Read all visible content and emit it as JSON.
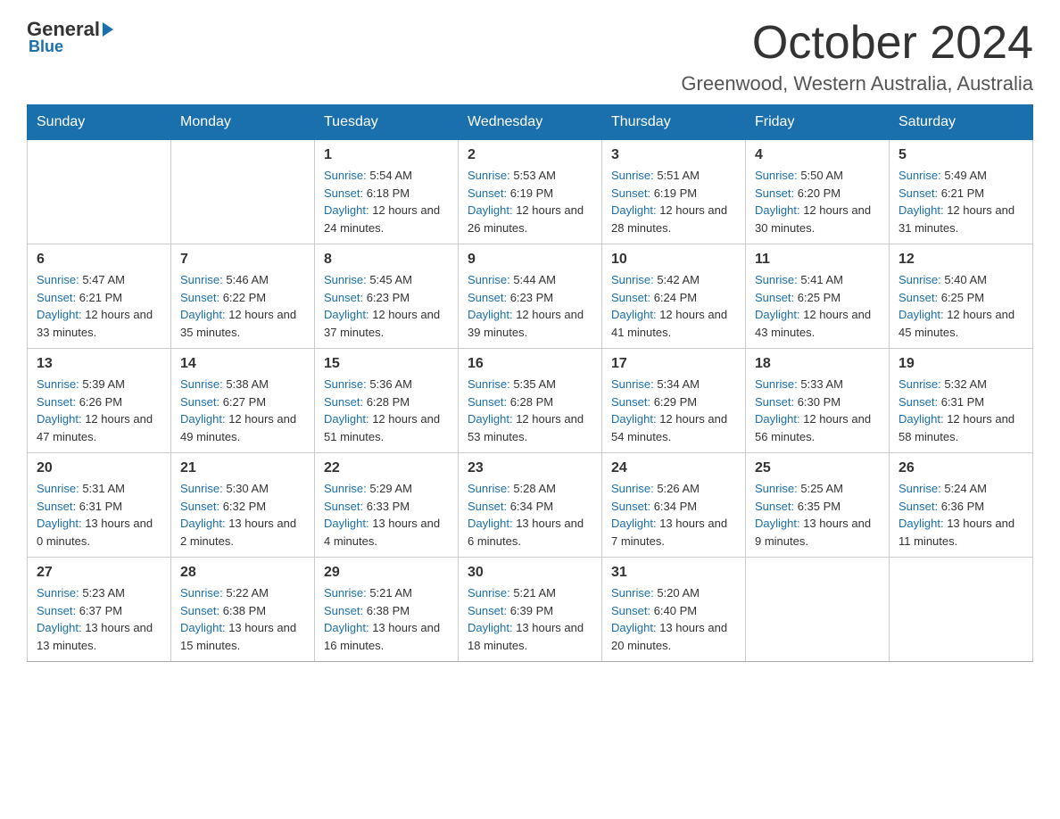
{
  "header": {
    "logo_general": "General",
    "logo_blue": "Blue",
    "month_title": "October 2024",
    "location": "Greenwood, Western Australia, Australia"
  },
  "days_of_week": [
    "Sunday",
    "Monday",
    "Tuesday",
    "Wednesday",
    "Thursday",
    "Friday",
    "Saturday"
  ],
  "weeks": [
    [
      {
        "day": "",
        "info": ""
      },
      {
        "day": "",
        "info": ""
      },
      {
        "day": "1",
        "sunrise": "5:54 AM",
        "sunset": "6:18 PM",
        "daylight": "12 hours and 24 minutes."
      },
      {
        "day": "2",
        "sunrise": "5:53 AM",
        "sunset": "6:19 PM",
        "daylight": "12 hours and 26 minutes."
      },
      {
        "day": "3",
        "sunrise": "5:51 AM",
        "sunset": "6:19 PM",
        "daylight": "12 hours and 28 minutes."
      },
      {
        "day": "4",
        "sunrise": "5:50 AM",
        "sunset": "6:20 PM",
        "daylight": "12 hours and 30 minutes."
      },
      {
        "day": "5",
        "sunrise": "5:49 AM",
        "sunset": "6:21 PM",
        "daylight": "12 hours and 31 minutes."
      }
    ],
    [
      {
        "day": "6",
        "sunrise": "5:47 AM",
        "sunset": "6:21 PM",
        "daylight": "12 hours and 33 minutes."
      },
      {
        "day": "7",
        "sunrise": "5:46 AM",
        "sunset": "6:22 PM",
        "daylight": "12 hours and 35 minutes."
      },
      {
        "day": "8",
        "sunrise": "5:45 AM",
        "sunset": "6:23 PM",
        "daylight": "12 hours and 37 minutes."
      },
      {
        "day": "9",
        "sunrise": "5:44 AM",
        "sunset": "6:23 PM",
        "daylight": "12 hours and 39 minutes."
      },
      {
        "day": "10",
        "sunrise": "5:42 AM",
        "sunset": "6:24 PM",
        "daylight": "12 hours and 41 minutes."
      },
      {
        "day": "11",
        "sunrise": "5:41 AM",
        "sunset": "6:25 PM",
        "daylight": "12 hours and 43 minutes."
      },
      {
        "day": "12",
        "sunrise": "5:40 AM",
        "sunset": "6:25 PM",
        "daylight": "12 hours and 45 minutes."
      }
    ],
    [
      {
        "day": "13",
        "sunrise": "5:39 AM",
        "sunset": "6:26 PM",
        "daylight": "12 hours and 47 minutes."
      },
      {
        "day": "14",
        "sunrise": "5:38 AM",
        "sunset": "6:27 PM",
        "daylight": "12 hours and 49 minutes."
      },
      {
        "day": "15",
        "sunrise": "5:36 AM",
        "sunset": "6:28 PM",
        "daylight": "12 hours and 51 minutes."
      },
      {
        "day": "16",
        "sunrise": "5:35 AM",
        "sunset": "6:28 PM",
        "daylight": "12 hours and 53 minutes."
      },
      {
        "day": "17",
        "sunrise": "5:34 AM",
        "sunset": "6:29 PM",
        "daylight": "12 hours and 54 minutes."
      },
      {
        "day": "18",
        "sunrise": "5:33 AM",
        "sunset": "6:30 PM",
        "daylight": "12 hours and 56 minutes."
      },
      {
        "day": "19",
        "sunrise": "5:32 AM",
        "sunset": "6:31 PM",
        "daylight": "12 hours and 58 minutes."
      }
    ],
    [
      {
        "day": "20",
        "sunrise": "5:31 AM",
        "sunset": "6:31 PM",
        "daylight": "13 hours and 0 minutes."
      },
      {
        "day": "21",
        "sunrise": "5:30 AM",
        "sunset": "6:32 PM",
        "daylight": "13 hours and 2 minutes."
      },
      {
        "day": "22",
        "sunrise": "5:29 AM",
        "sunset": "6:33 PM",
        "daylight": "13 hours and 4 minutes."
      },
      {
        "day": "23",
        "sunrise": "5:28 AM",
        "sunset": "6:34 PM",
        "daylight": "13 hours and 6 minutes."
      },
      {
        "day": "24",
        "sunrise": "5:26 AM",
        "sunset": "6:34 PM",
        "daylight": "13 hours and 7 minutes."
      },
      {
        "day": "25",
        "sunrise": "5:25 AM",
        "sunset": "6:35 PM",
        "daylight": "13 hours and 9 minutes."
      },
      {
        "day": "26",
        "sunrise": "5:24 AM",
        "sunset": "6:36 PM",
        "daylight": "13 hours and 11 minutes."
      }
    ],
    [
      {
        "day": "27",
        "sunrise": "5:23 AM",
        "sunset": "6:37 PM",
        "daylight": "13 hours and 13 minutes."
      },
      {
        "day": "28",
        "sunrise": "5:22 AM",
        "sunset": "6:38 PM",
        "daylight": "13 hours and 15 minutes."
      },
      {
        "day": "29",
        "sunrise": "5:21 AM",
        "sunset": "6:38 PM",
        "daylight": "13 hours and 16 minutes."
      },
      {
        "day": "30",
        "sunrise": "5:21 AM",
        "sunset": "6:39 PM",
        "daylight": "13 hours and 18 minutes."
      },
      {
        "day": "31",
        "sunrise": "5:20 AM",
        "sunset": "6:40 PM",
        "daylight": "13 hours and 20 minutes."
      },
      {
        "day": "",
        "info": ""
      },
      {
        "day": "",
        "info": ""
      }
    ]
  ],
  "labels": {
    "sunrise": "Sunrise: ",
    "sunset": "Sunset: ",
    "daylight": "Daylight: "
  }
}
